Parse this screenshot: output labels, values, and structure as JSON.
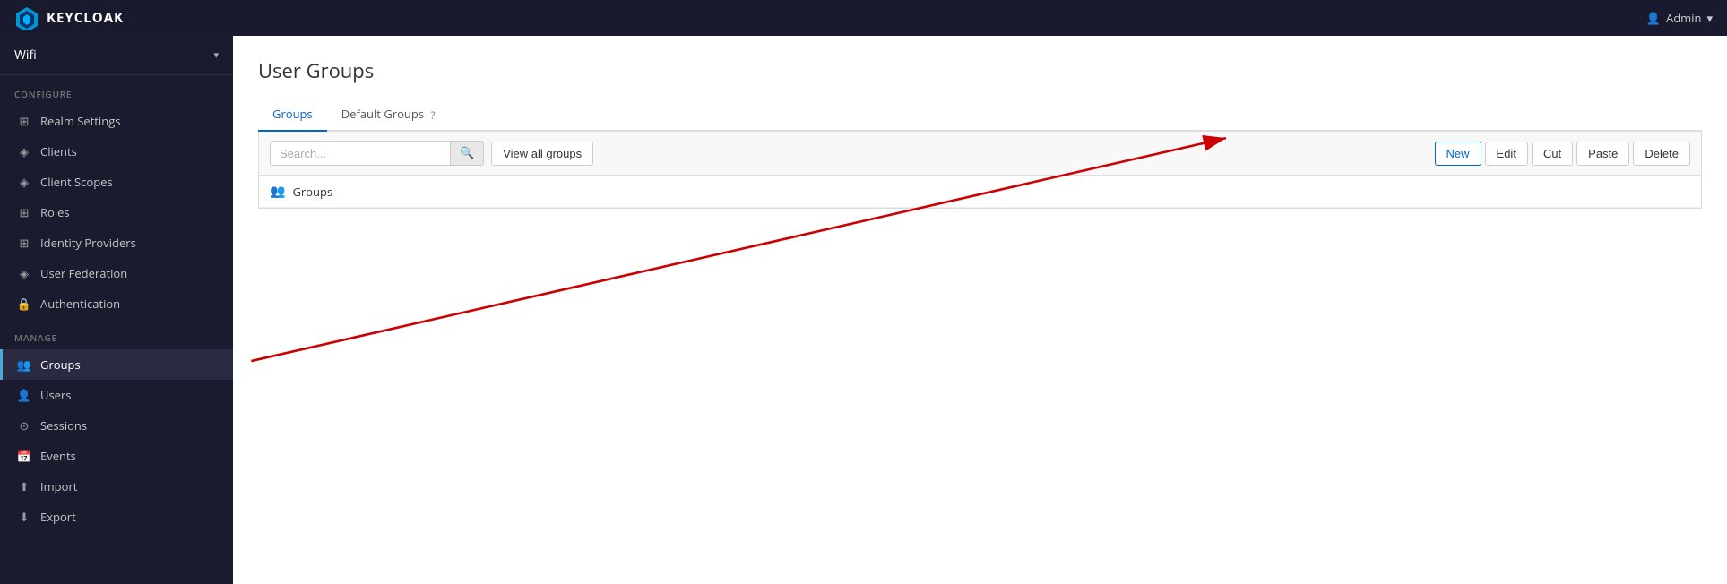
{
  "navbar": {
    "brand": "KEYCLOAK",
    "user_label": "Admin",
    "user_icon": "▾"
  },
  "sidebar": {
    "realm": "Wifi",
    "realm_chevron": "▾",
    "configure_label": "Configure",
    "configure_items": [
      {
        "id": "realm-settings",
        "label": "Realm Settings",
        "icon": "⊞"
      },
      {
        "id": "clients",
        "label": "Clients",
        "icon": "◈"
      },
      {
        "id": "client-scopes",
        "label": "Client Scopes",
        "icon": "◈"
      },
      {
        "id": "roles",
        "label": "Roles",
        "icon": "⊞"
      },
      {
        "id": "identity-providers",
        "label": "Identity Providers",
        "icon": "⊞"
      },
      {
        "id": "user-federation",
        "label": "User Federation",
        "icon": "◈"
      },
      {
        "id": "authentication",
        "label": "Authentication",
        "icon": "🔒"
      }
    ],
    "manage_label": "Manage",
    "manage_items": [
      {
        "id": "groups",
        "label": "Groups",
        "icon": "👥",
        "active": true
      },
      {
        "id": "users",
        "label": "Users",
        "icon": "👤"
      },
      {
        "id": "sessions",
        "label": "Sessions",
        "icon": "⊙"
      },
      {
        "id": "events",
        "label": "Events",
        "icon": "📅"
      },
      {
        "id": "import",
        "label": "Import",
        "icon": "⬆"
      },
      {
        "id": "export",
        "label": "Export",
        "icon": "⬇"
      }
    ]
  },
  "content": {
    "page_title": "User Groups",
    "tabs": [
      {
        "id": "groups",
        "label": "Groups",
        "active": true
      },
      {
        "id": "default-groups",
        "label": "Default Groups",
        "help": "?"
      }
    ],
    "toolbar": {
      "search_placeholder": "Search...",
      "view_all_label": "View all groups",
      "buttons": [
        {
          "id": "new",
          "label": "New"
        },
        {
          "id": "edit",
          "label": "Edit"
        },
        {
          "id": "cut",
          "label": "Cut"
        },
        {
          "id": "paste",
          "label": "Paste"
        },
        {
          "id": "delete",
          "label": "Delete"
        }
      ]
    },
    "groups_row": {
      "icon": "👥",
      "name": "Groups"
    }
  }
}
